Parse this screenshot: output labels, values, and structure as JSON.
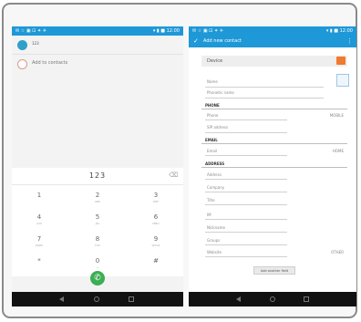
{
  "left_phone": {
    "status_left": "✉ ☆ ▣ ⊡ ✦ ✈",
    "status_right": "▾ ▮ ■ 12:00",
    "suggestions": [
      {
        "label": "123",
        "avatar": "teal"
      },
      {
        "label": "Add to contacts",
        "avatar": "outline"
      }
    ],
    "dialed_number": "123",
    "backspace_icon": "backspace-icon",
    "keys": [
      {
        "num": "1",
        "letters": ""
      },
      {
        "num": "2",
        "letters": "ABC"
      },
      {
        "num": "3",
        "letters": "DEF"
      },
      {
        "num": "4",
        "letters": "GHI"
      },
      {
        "num": "5",
        "letters": "JKL"
      },
      {
        "num": "6",
        "letters": "MNO"
      },
      {
        "num": "7",
        "letters": "PQRS"
      },
      {
        "num": "8",
        "letters": "TUV"
      },
      {
        "num": "9",
        "letters": "WXYZ"
      },
      {
        "num": "*",
        "letters": ""
      },
      {
        "num": "0",
        "letters": "+"
      },
      {
        "num": "#",
        "letters": ""
      }
    ],
    "call_icon": "phone-icon"
  },
  "right_phone": {
    "status_left": "✉ ☆ ▣ ⊡ ✦ ✈",
    "status_right": "▾ ▮ ■ 12:00",
    "title": "Add new contact",
    "account": "Device",
    "fields": {
      "name": "Name",
      "phonetic": "Phonetic name",
      "phone_section": "PHONE",
      "phone": "Phone",
      "phone_type": "MOBILE",
      "sip_address": "SIP address",
      "email_section": "EMAIL",
      "email": "Email",
      "email_type": "HOME",
      "address_section": "ADDRESS",
      "address": "Address",
      "company": "Company",
      "job_title": "Title",
      "ime": "IM",
      "nickname": "Nickname",
      "group": "Groups",
      "website": "Website",
      "website_type": "OTHER"
    },
    "add_button": "Add another field"
  },
  "colors": {
    "status_blue": "#1e98d7",
    "call_green": "#3cae54",
    "account_orange": "#f07a2d"
  }
}
